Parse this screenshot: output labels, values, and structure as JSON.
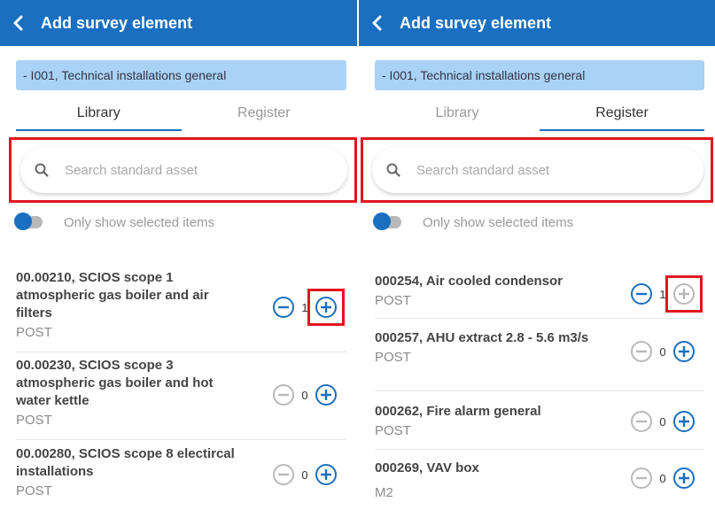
{
  "colors": {
    "primary": "#1a6fc0",
    "highlight": "#e0161e",
    "breadcrumb_bg": "#a9d2f5",
    "disabled": "#b9b9b9"
  },
  "panels": [
    {
      "header": {
        "back_icon": "chevron-left-icon",
        "title": "Add survey element"
      },
      "breadcrumb": "- I001, Technical installations general",
      "tabs": [
        {
          "label": "Library",
          "active": true
        },
        {
          "label": "Register",
          "active": false
        }
      ],
      "search": {
        "icon": "search-icon",
        "placeholder": "Search standard asset",
        "value": ""
      },
      "toggle": {
        "label": "Only show selected items",
        "on": false
      },
      "items": [
        {
          "name": "00.00210, SCIOS scope 1 atmospheric gas boiler and air filters",
          "sub": "POST",
          "count": "1"
        },
        {
          "name": "00.00230, SCIOS scope 3 atmospheric gas boiler and hot water kettle",
          "sub": "POST",
          "count": "0"
        },
        {
          "name": "00.00280, SCIOS scope 8 electircal installations",
          "sub": "POST",
          "count": "0"
        }
      ]
    },
    {
      "header": {
        "back_icon": "chevron-left-icon",
        "title": "Add survey element"
      },
      "breadcrumb": "- I001, Technical installations general",
      "tabs": [
        {
          "label": "Library",
          "active": false
        },
        {
          "label": "Register",
          "active": true
        }
      ],
      "search": {
        "icon": "search-icon",
        "placeholder": "Search standard asset",
        "value": ""
      },
      "toggle": {
        "label": "Only show selected items",
        "on": false
      },
      "items": [
        {
          "name": "000254, Air cooled condensor",
          "sub": "POST",
          "count": "1"
        },
        {
          "name": "000257, AHU extract 2.8 - 5.6 m3/s",
          "sub": "POST",
          "count": "0"
        },
        {
          "name": "000262, Fire alarm general",
          "sub": "POST",
          "count": "0"
        },
        {
          "name": "000269, VAV box",
          "sub": "M2",
          "count": "0"
        }
      ]
    }
  ]
}
